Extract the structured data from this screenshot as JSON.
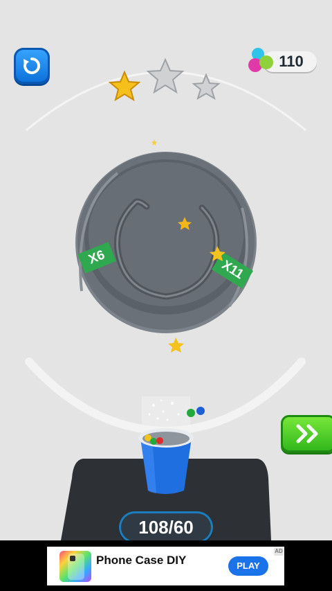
{
  "hud": {
    "restart_icon": "restart-icon",
    "coin_icon": "colored-balls-icon",
    "coins": "110",
    "stars_earned": 1,
    "stars_total": 3
  },
  "board": {
    "multipliers": [
      {
        "label": "X6"
      },
      {
        "label": "X11"
      }
    ],
    "accent_green": "#2fa84f",
    "disc_color": "#5b6168"
  },
  "cup": {
    "color": "#1f6fe0",
    "balls_inside": [
      "yellow",
      "green",
      "red"
    ],
    "balls_falling": [
      "green",
      "blue"
    ]
  },
  "progress": {
    "score_text": "108/60"
  },
  "next_button": {
    "icon": "double-chevron-right-icon",
    "color": "#3dc423"
  },
  "ad": {
    "title": "Phone Case DIY",
    "cta": "PLAY",
    "badge": "AD"
  }
}
